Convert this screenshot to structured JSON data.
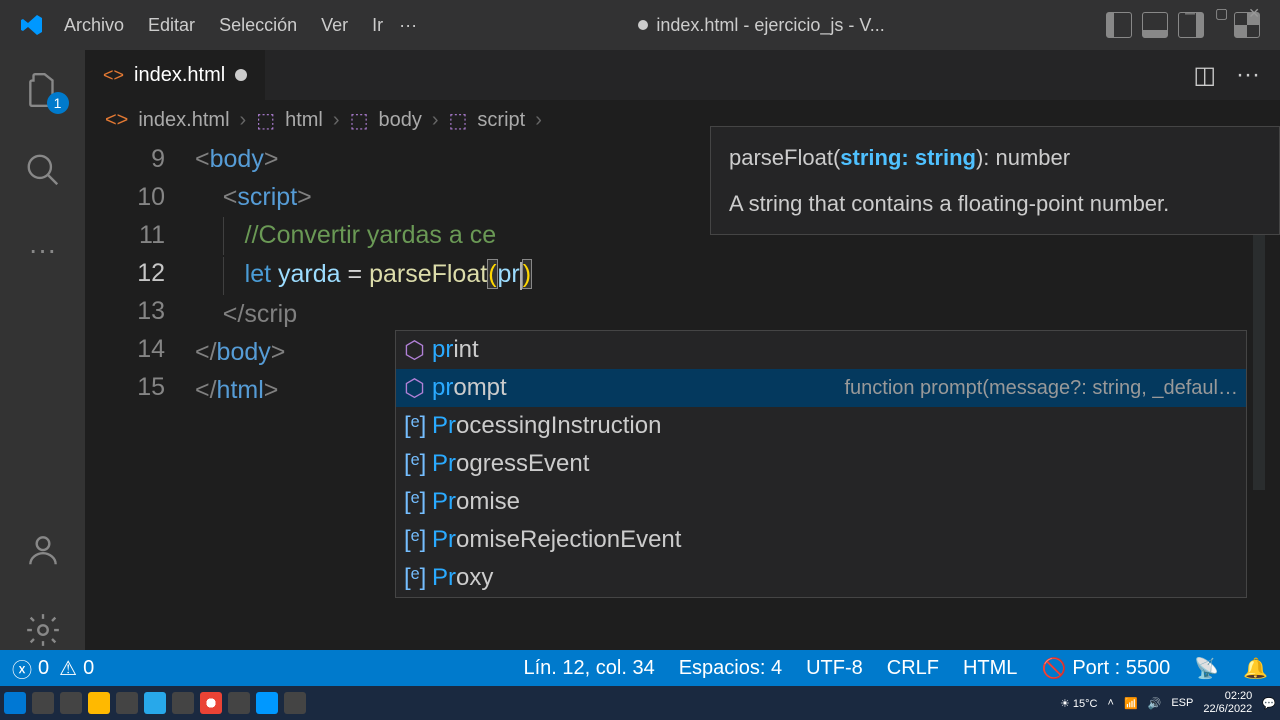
{
  "menu": {
    "archivo": "Archivo",
    "editar": "Editar",
    "seleccion": "Selección",
    "ver": "Ver",
    "ir": "Ir"
  },
  "window_title": "index.html - ejercicio_js - V...",
  "activity": {
    "explorer_badge": "1"
  },
  "tab": {
    "filename": "index.html"
  },
  "breadcrumbs": {
    "file": "index.html",
    "p1": "html",
    "p2": "body",
    "p3": "script"
  },
  "code": {
    "ln9": "9",
    "ln10": "10",
    "ln11": "11",
    "ln12": "12",
    "ln13": "13",
    "ln14": "14",
    "ln15": "15",
    "body_open_lt": "<",
    "body_open": "body",
    "gt": ">",
    "script_open": "script",
    "comment": "//Convertir yardas a ce",
    "let": "let",
    "var": "yarda",
    "eq": "=",
    "fn": "parseFloat",
    "lparen": "(",
    "typed": "pr",
    "rparen": ")",
    "script_close": "</scrip",
    "cls_lt": "</",
    "body_close": "body",
    "html_close": "html"
  },
  "sighelp": {
    "pre": "parseFloat(",
    "param": "string: string",
    "post": "): number",
    "desc": "A string that contains a floating-point number."
  },
  "suggest": {
    "items": [
      {
        "kind": "fn",
        "pre": "pr",
        "rest": "int"
      },
      {
        "kind": "fn",
        "pre": "pr",
        "rest": "ompt",
        "detail": "function prompt(message?: string, _defaul…"
      },
      {
        "kind": "var",
        "pre": "Pr",
        "rest": "ocessingInstruction"
      },
      {
        "kind": "var",
        "pre": "Pr",
        "rest": "ogressEvent"
      },
      {
        "kind": "var",
        "pre": "Pr",
        "rest": "omise"
      },
      {
        "kind": "var",
        "pre": "Pr",
        "rest": "omiseRejectionEvent"
      },
      {
        "kind": "var",
        "pre": "Pr",
        "rest": "oxy"
      }
    ],
    "selected": 1
  },
  "statusbar": {
    "errors": "0",
    "warnings": "0",
    "pos": "Lín. 12, col. 34",
    "spaces": "Espacios: 4",
    "enc": "UTF-8",
    "eol": "CRLF",
    "lang": "HTML",
    "port": "Port : 5500"
  },
  "taskbar": {
    "temp": "15°C",
    "lang": "ESP",
    "time": "02:20",
    "date": "22/6/2022"
  }
}
